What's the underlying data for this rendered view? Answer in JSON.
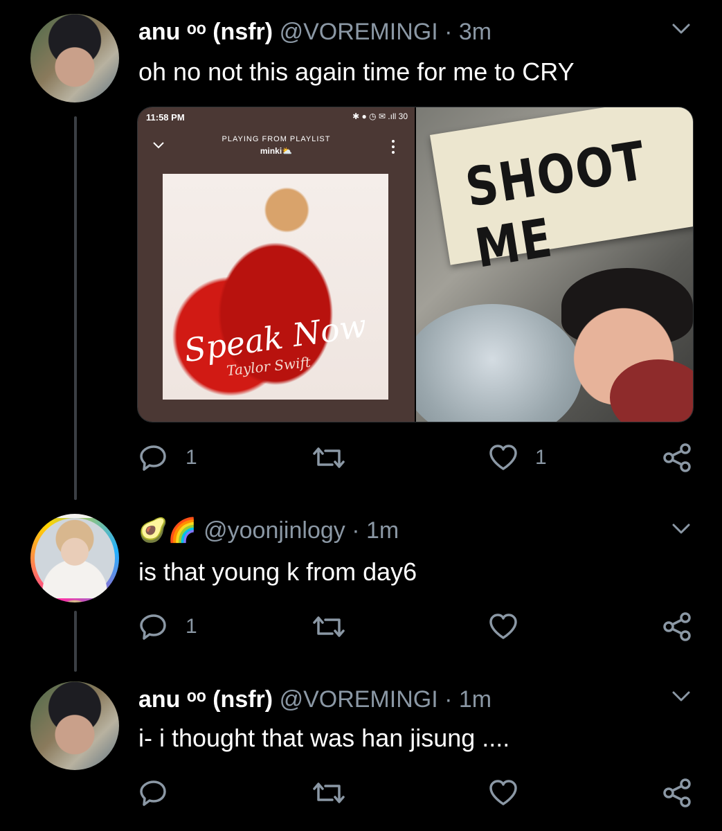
{
  "colors": {
    "background": "#000000",
    "muted": "#8b98a5",
    "thread_line": "#3b3f44"
  },
  "tweets": [
    {
      "name": "anu ᵒᵒ (nsfr)",
      "handle": "@VOREMINGI",
      "separator": "·",
      "time": "3m",
      "text": "oh no not this again time for me to CRY",
      "replies": "1",
      "retweets": "",
      "likes": "1",
      "media": {
        "phone_time": "11:58 PM",
        "phone_status_icons": "✱ ● ◷ ✉ .ıll 30",
        "playing_from": "PLAYING FROM PLAYLIST",
        "playlist_name": "minki⛅",
        "album_title": "Speak Now",
        "album_artist": "Taylor Swift",
        "sign_text": "SHOOT ME"
      }
    },
    {
      "name": "🥑🌈",
      "handle": "@yoonjinlogy",
      "separator": "·",
      "time": "1m",
      "text": "is that young k from day6",
      "replies": "1",
      "retweets": "",
      "likes": ""
    },
    {
      "name": "anu ᵒᵒ (nsfr)",
      "handle": "@VOREMINGI",
      "separator": "·",
      "time": "1m",
      "text": "i- i thought that was han jisung ....",
      "replies": "",
      "retweets": "",
      "likes": ""
    }
  ],
  "icons": {
    "reply": "reply-icon",
    "retweet": "retweet-icon",
    "like": "heart-icon",
    "share": "share-icon",
    "caret": "chevron-down-icon"
  }
}
